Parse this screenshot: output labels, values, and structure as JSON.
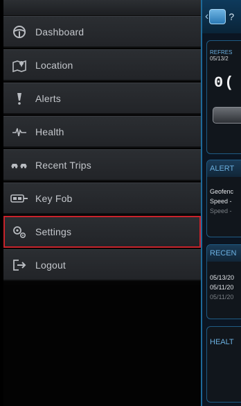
{
  "menu": {
    "items": [
      {
        "label": "Dashboard",
        "icon": "steering-wheel-icon"
      },
      {
        "label": "Location",
        "icon": "map-pin-icon"
      },
      {
        "label": "Alerts",
        "icon": "exclamation-icon"
      },
      {
        "label": "Health",
        "icon": "heartbeat-icon"
      },
      {
        "label": "Recent Trips",
        "icon": "car-trips-icon"
      },
      {
        "label": "Key Fob",
        "icon": "key-fob-icon"
      },
      {
        "label": "Settings",
        "icon": "gears-icon",
        "selected": true
      },
      {
        "label": "Logout",
        "icon": "logout-icon"
      }
    ],
    "selected_color": "#c8232b"
  },
  "app": {
    "back": "‹",
    "title": "?",
    "refresh": {
      "label": "REFRES",
      "date": "05/13/2",
      "odometer": "0("
    },
    "alerts": {
      "title": "ALERT",
      "lines": [
        "Geofenc",
        "Speed -",
        "Speed -"
      ]
    },
    "recent": {
      "title": "RECEN",
      "lines": [
        "05/13/20",
        "05/11/20",
        "05/11/20"
      ]
    },
    "health": {
      "title": "HEALT"
    }
  },
  "colors": {
    "accent": "#1e6a9a",
    "label": "#c4c7cc",
    "background": "#000000"
  }
}
